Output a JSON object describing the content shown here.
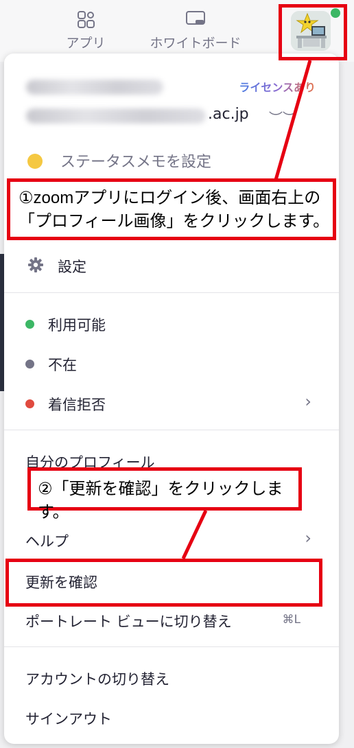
{
  "toolbar": {
    "apps_label": "アプリ",
    "whiteboard_label": "ホワイトボード"
  },
  "menu": {
    "license": "ライセンスあり",
    "email_suffix": ".ac.jp",
    "status_memo": "ステータスメモを設定",
    "settings": "設定",
    "status_available": "利用可能",
    "status_away": "不在",
    "status_dnd": "着信拒否",
    "my_profile": "自分のプロフィール",
    "help": "ヘルプ",
    "check_updates": "更新を確認",
    "portrait_view": "ポートレート ビューに切り替え",
    "portrait_shortcut": "⌘L",
    "switch_account": "アカウントの切り替え",
    "sign_out": "サインアウト"
  },
  "annotations": {
    "step1_line1": "①zoomアプリにログイン後、画面右上の",
    "step1_line2": "「プロフィール画像」をクリックします。",
    "step2": "②「更新を確認」をクリックします。"
  },
  "colors": {
    "annotation_red": "#e60012",
    "status_available": "#3cb765",
    "status_away": "#747487",
    "status_dnd": "#e04a3f"
  }
}
